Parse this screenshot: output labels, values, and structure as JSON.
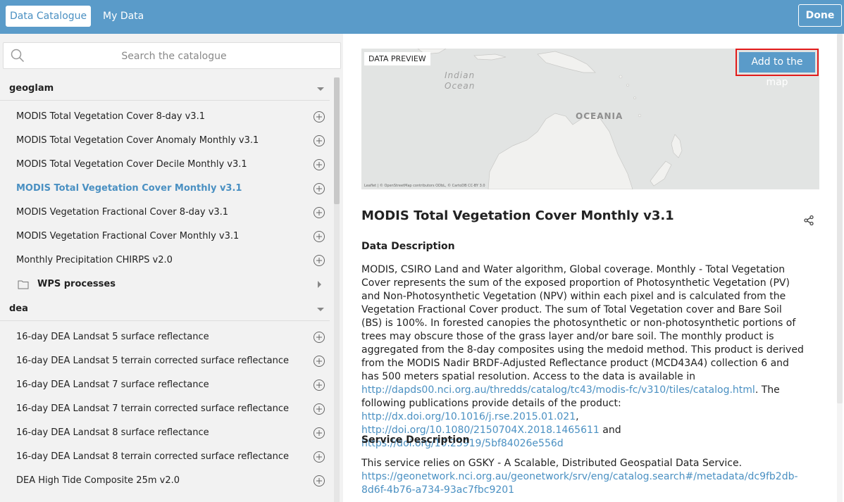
{
  "topbar": {
    "tab_catalogue": "Data Catalogue",
    "tab_mydata": "My Data",
    "done": "Done"
  },
  "search": {
    "placeholder": "Search the catalogue"
  },
  "groups": {
    "geoglam": {
      "label": "geoglam",
      "items": [
        "MODIS Total Vegetation Cover 8-day v3.1",
        "MODIS Total Vegetation Cover Anomaly Monthly v3.1",
        "MODIS Total Vegetation Cover Decile Monthly v3.1",
        "MODIS Total Vegetation Cover Monthly v3.1",
        "MODIS Vegetation Fractional Cover 8-day v3.1",
        "MODIS Vegetation Fractional Cover Monthly v3.1",
        "Monthly Precipitation CHIRPS v2.0"
      ],
      "folder": "WPS processes"
    },
    "dea": {
      "label": "dea",
      "items": [
        "16-day DEA Landsat 5 surface reflectance",
        "16-day DEA Landsat 5 terrain corrected surface reflectance",
        "16-day DEA Landsat 7 surface reflectance",
        "16-day DEA Landsat 7 terrain corrected surface reflectance",
        "16-day DEA Landsat 8 surface reflectance",
        "16-day DEA Landsat 8 terrain corrected surface reflectance",
        "DEA High Tide Composite 25m v2.0"
      ]
    }
  },
  "preview": {
    "label": "DATA PREVIEW",
    "add_button": "Add to the map",
    "map_labels": {
      "ocean_line1": "Indian",
      "ocean_line2": "Ocean",
      "region": "OCEANIA"
    },
    "attribution": "Leaflet | © OpenStreetMap contributors ODbL, © CartoDB CC-BY 3.0"
  },
  "detail": {
    "title": "MODIS Total Vegetation Cover Monthly v3.1",
    "data_description_heading": "Data Description",
    "data_description_text": "MODIS, CSIRO Land and Water algorithm, Global coverage. Monthly - Total Vegetation Cover represents the sum of the exposed proportion of Photosynthetic Vegetation (PV) and Non-Photosynthetic Vegetation (NPV) within each pixel and is calculated from the Vegetation Fractional Cover product. The sum of Total Vegetation cover and Bare Soil (BS) is 100%. In forested canopies the photosynthetic or non-photosynthetic portions of trees may obscure those of the grass layer and/or bare soil. The monthly product is aggregated from the 8-day composites using the medoid method. This product is derived from the MODIS Nadir BRDF-Adjusted Reflectance product (MCD43A4) collection 6 and has 500 meters spatial resolution. Access to the data is available in ",
    "link1": "http://dapds00.nci.org.au/thredds/catalog/tc43/modis-fc/v310/tiles/catalog.html",
    "text2": ". The following publications provide details of the product: ",
    "link2": "http://dx.doi.org/10.1016/j.rse.2015.01.021",
    "sep": ", ",
    "link3": "http://doi.org/10.1080/2150704X.2018.1465611",
    "and": " and ",
    "link4": "https://doi.org/10.25919/5bf84026e556d",
    "service_heading": "Service Description",
    "service_text": "This service relies on GSKY - A Scalable, Distributed Geospatial Data Service. ",
    "service_link": "https://geonetwork.nci.org.au/geonetwork/srv/eng/catalog.search#/metadata/dc9fb2db-8d6f-4b76-a734-93ac7fbc9201"
  },
  "colors": {
    "accent": "#5a9bc9",
    "link": "#4a90c2",
    "highlight": "#e21b1b"
  }
}
